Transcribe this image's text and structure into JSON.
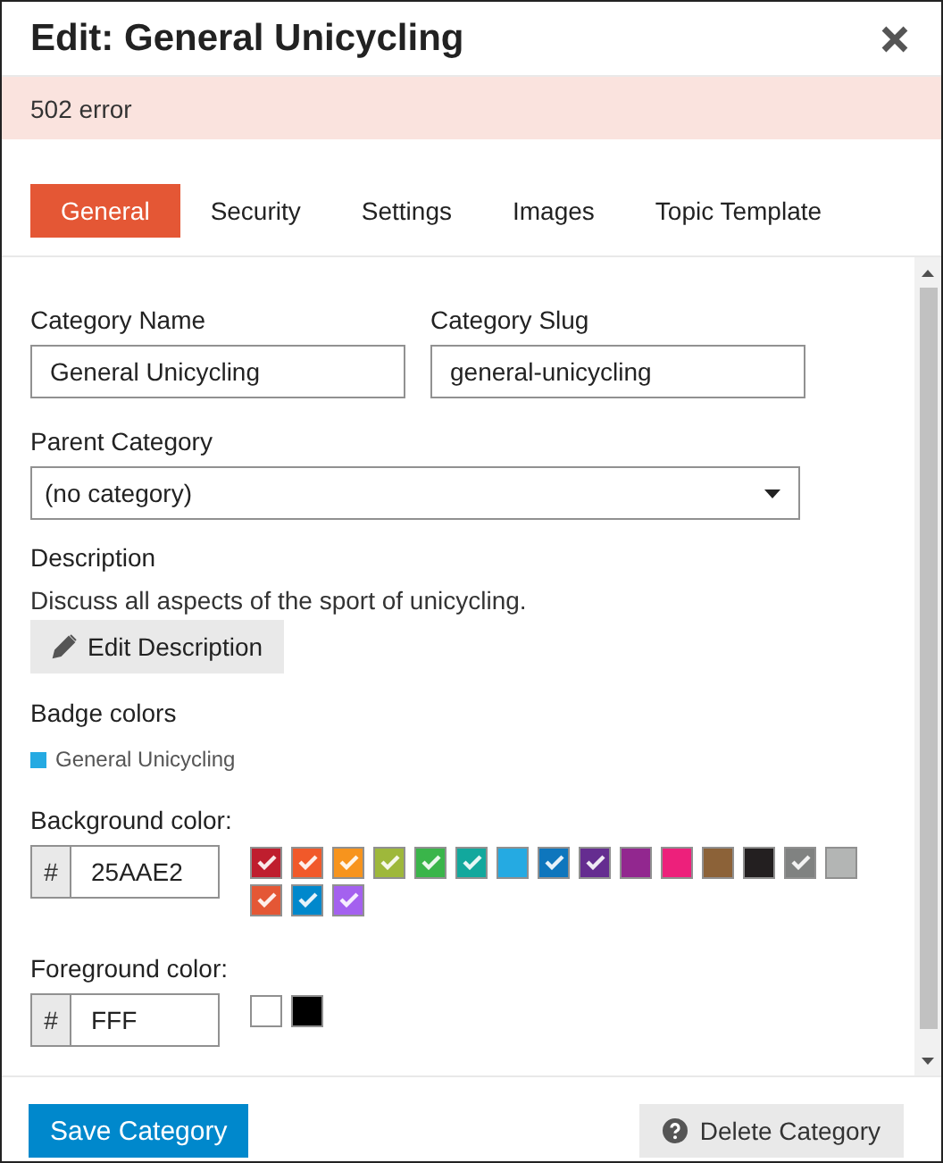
{
  "title": "Edit: General Unicycling",
  "alert": "502 error",
  "tabs": [
    {
      "label": "General",
      "selected": true
    },
    {
      "label": "Security",
      "selected": false
    },
    {
      "label": "Settings",
      "selected": false
    },
    {
      "label": "Images",
      "selected": false
    },
    {
      "label": "Topic Template",
      "selected": false
    }
  ],
  "name_field": {
    "label": "Category Name",
    "value": "General Unicycling"
  },
  "slug_field": {
    "label": "Category Slug",
    "value": "general-unicycling"
  },
  "parent": {
    "label": "Parent Category",
    "value": "(no category)"
  },
  "description": {
    "label": "Description",
    "text": "Discuss all aspects of the sport of unicycling.",
    "button": "Edit Description"
  },
  "badge": {
    "label": "Badge colors",
    "name": "General Unicycling",
    "color": "#25aae2"
  },
  "background": {
    "label": "Background color:",
    "prefix": "#",
    "value": "25AAE2",
    "swatches": [
      {
        "color": "#bf1e2e",
        "checked": true
      },
      {
        "color": "#f1592a",
        "checked": true
      },
      {
        "color": "#f7941d",
        "checked": true
      },
      {
        "color": "#9eb83b",
        "checked": true
      },
      {
        "color": "#3ab54a",
        "checked": true
      },
      {
        "color": "#12a89d",
        "checked": true
      },
      {
        "color": "#25aae2",
        "checked": false
      },
      {
        "color": "#0e76bd",
        "checked": true
      },
      {
        "color": "#652d90",
        "checked": true
      },
      {
        "color": "#92278f",
        "checked": false
      },
      {
        "color": "#ed207b",
        "checked": false
      },
      {
        "color": "#8c6238",
        "checked": false
      },
      {
        "color": "#231f20",
        "checked": false
      },
      {
        "color": "#808281",
        "checked": true
      },
      {
        "color": "#b3b5b4",
        "checked": false
      },
      {
        "color": "#e45735",
        "checked": true
      },
      {
        "color": "#0088cc",
        "checked": true
      },
      {
        "color": "#a461ef",
        "checked": true
      }
    ]
  },
  "foreground": {
    "label": "Foreground color:",
    "prefix": "#",
    "value": "FFF",
    "swatches": [
      {
        "color": "#ffffff",
        "checked": false
      },
      {
        "color": "#000000",
        "checked": false
      }
    ]
  },
  "footer": {
    "save": "Save Category",
    "delete": "Delete Category"
  }
}
